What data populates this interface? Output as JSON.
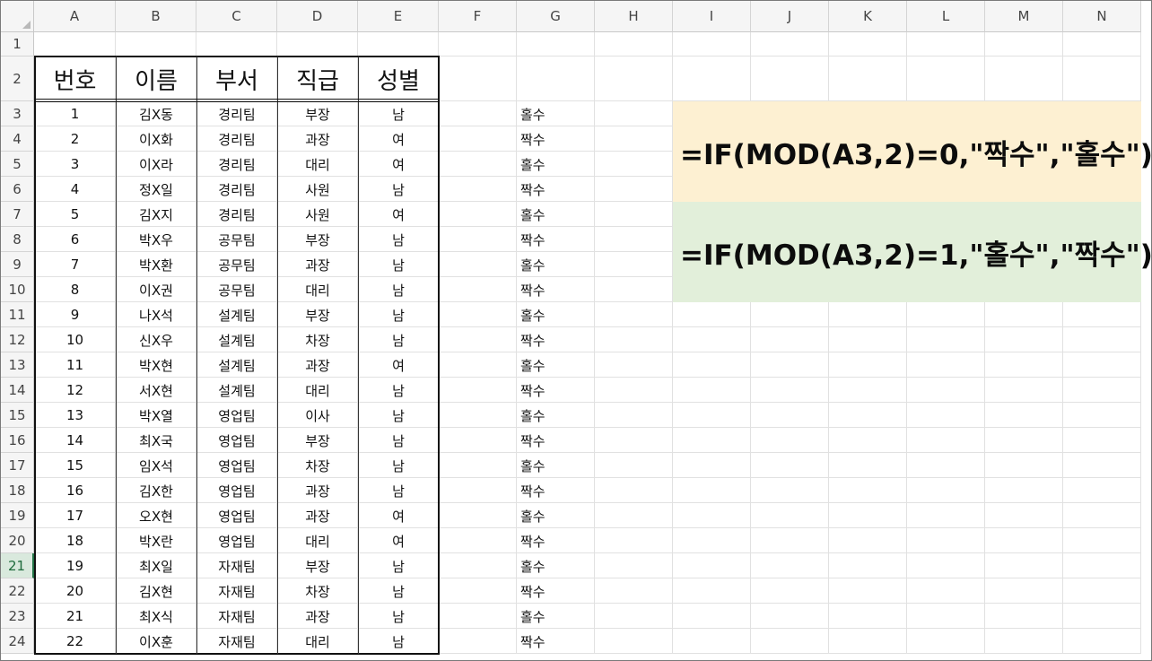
{
  "columns": [
    "A",
    "B",
    "C",
    "D",
    "E",
    "F",
    "G",
    "H",
    "I",
    "J",
    "K",
    "L",
    "M",
    "N"
  ],
  "rows": [
    "1",
    "2",
    "3",
    "4",
    "5",
    "6",
    "7",
    "8",
    "9",
    "10",
    "11",
    "12",
    "13",
    "14",
    "15",
    "16",
    "17",
    "18",
    "19",
    "20",
    "21",
    "22",
    "23",
    "24"
  ],
  "active_row": "21",
  "table_headers": [
    "번호",
    "이름",
    "부서",
    "직급",
    "성별"
  ],
  "table_rows": [
    [
      "1",
      "김X동",
      "경리팀",
      "부장",
      "남"
    ],
    [
      "2",
      "이X화",
      "경리팀",
      "과장",
      "여"
    ],
    [
      "3",
      "이X라",
      "경리팀",
      "대리",
      "여"
    ],
    [
      "4",
      "정X일",
      "경리팀",
      "사원",
      "남"
    ],
    [
      "5",
      "김X지",
      "경리팀",
      "사원",
      "여"
    ],
    [
      "6",
      "박X우",
      "공무팀",
      "부장",
      "남"
    ],
    [
      "7",
      "박X환",
      "공무팀",
      "과장",
      "남"
    ],
    [
      "8",
      "이X권",
      "공무팀",
      "대리",
      "남"
    ],
    [
      "9",
      "나X석",
      "설계팀",
      "부장",
      "남"
    ],
    [
      "10",
      "신X우",
      "설계팀",
      "차장",
      "남"
    ],
    [
      "11",
      "박X현",
      "설계팀",
      "과장",
      "여"
    ],
    [
      "12",
      "서X현",
      "설계팀",
      "대리",
      "남"
    ],
    [
      "13",
      "박X열",
      "영업팀",
      "이사",
      "남"
    ],
    [
      "14",
      "최X국",
      "영업팀",
      "부장",
      "남"
    ],
    [
      "15",
      "임X석",
      "영업팀",
      "차장",
      "남"
    ],
    [
      "16",
      "김X한",
      "영업팀",
      "과장",
      "남"
    ],
    [
      "17",
      "오X현",
      "영업팀",
      "과장",
      "여"
    ],
    [
      "18",
      "박X란",
      "영업팀",
      "대리",
      "여"
    ],
    [
      "19",
      "최X일",
      "자재팀",
      "부장",
      "남"
    ],
    [
      "20",
      "김X현",
      "자재팀",
      "차장",
      "남"
    ],
    [
      "21",
      "최X식",
      "자재팀",
      "과장",
      "남"
    ],
    [
      "22",
      "이X훈",
      "자재팀",
      "대리",
      "남"
    ]
  ],
  "column_g": [
    "홀수",
    "짝수",
    "홀수",
    "짝수",
    "홀수",
    "짝수",
    "홀수",
    "짝수",
    "홀수",
    "짝수",
    "홀수",
    "짝수",
    "홀수",
    "짝수",
    "홀수",
    "짝수",
    "홀수",
    "짝수",
    "홀수",
    "짝수",
    "홀수",
    "짝수"
  ],
  "formulas": [
    {
      "text": "=IF(MOD(A3,2)=0,\"짝수\",\"홀수\")",
      "bg": "#fdf0d2"
    },
    {
      "text": "=IF(MOD(A3,2)=1,\"홀수\",\"짝수\")",
      "bg": "#e2efda"
    }
  ],
  "colors": {
    "header_bg": "#f5f5f5",
    "gridline": "#e1e1e1",
    "active_row_accent": "#217346"
  }
}
